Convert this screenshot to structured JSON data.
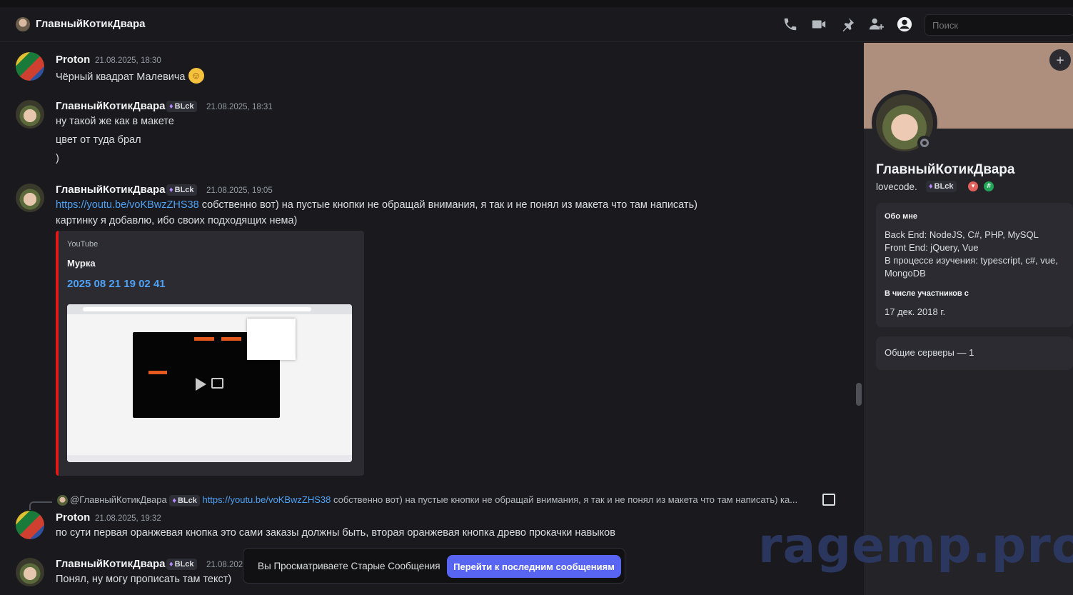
{
  "header": {
    "title": "ГлавныйКотикДвара",
    "icons": [
      "phone-icon",
      "video-icon",
      "pin-icon",
      "add-member-icon",
      "user-profile-icon"
    ],
    "search_placeholder": "Поиск"
  },
  "messages": [
    {
      "author": "Proton",
      "timestamp": "21.08.2025, 18:30",
      "lines": [
        "Чёрный квадрат Малевича"
      ],
      "emoji": "grinning-face"
    },
    {
      "author": "ГлавныйКотикДвара",
      "badge": "BLck",
      "timestamp": "21.08.2025, 18:31",
      "lines": [
        "ну такой же как в макете",
        "цвет от туда брал",
        ")"
      ]
    },
    {
      "author": "ГлавныйКотикДвара",
      "badge": "BLck",
      "timestamp": "21.08.2025, 19:05",
      "link": "https://youtu.be/voKBwzZHS38",
      "line1_rest": " собственно вот) на пустые кнопки не обращай внимания, я так и не понял из макета что там написать)",
      "line2": "картинку я добавлю, ибо своих подходящих нема)",
      "embed": {
        "provider": "YouTube",
        "author": "Мурка",
        "title": "2025 08 21 19 02 41"
      }
    },
    {
      "reply": {
        "mention": "@ГлавныйКотикДвара",
        "badge": "BLck",
        "link": "https://youtu.be/voKBwzZHS38",
        "text": " собственно вот) на пустые кнопки не обращай внимания, я так и не понял из макета что там написать) ка..."
      },
      "author": "Proton",
      "timestamp": "21.08.2025, 19:32",
      "lines": [
        "по сути первая оранжевая кнопка это сами заказы должны быть, вторая оранжевая кнопка древо прокачки навыков"
      ]
    },
    {
      "author": "ГлавныйКотикДвара",
      "badge": "BLck",
      "timestamp": "21.08.202",
      "lines": [
        "Понял, ну могу прописать там текст)"
      ]
    }
  ],
  "jump_bar": {
    "text": "Вы Просматриваете Старые Сообщения",
    "button": "Перейти к последним сообщениям"
  },
  "watermark": "ragemp.pro",
  "profile": {
    "name": "ГлавныйКотикДвара",
    "username": "lovecode.",
    "badge": "BLck",
    "about_heading": "Обо мне",
    "about_lines": [
      "Back End: NodeJS, C#, PHP, MySQL",
      "Front End: jQuery, Vue",
      "В процессе изучения: typescript, c#, vue,",
      "MongoDB"
    ],
    "member_heading": "В числе участников с",
    "member_since": "17 дек. 2018 г.",
    "mutual_servers": "Общие серверы — 1"
  },
  "colors": {
    "background": "#1a1a1e",
    "panel": "#232328",
    "accent_button": "#5865f2",
    "link": "#4ea1f5",
    "embed_border": "#e3191a",
    "banner": "#ae8f7d"
  }
}
